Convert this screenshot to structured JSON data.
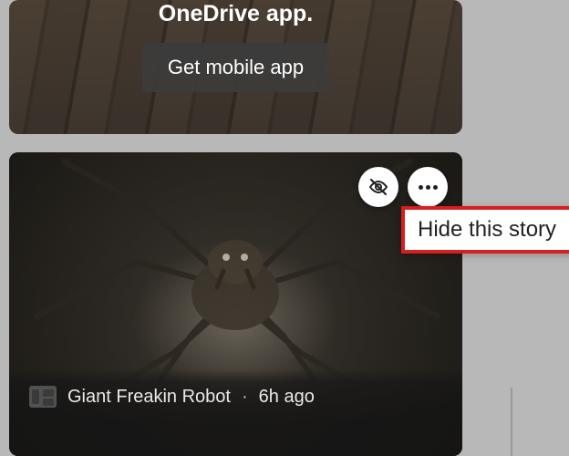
{
  "promo": {
    "line2": "OneDrive app.",
    "button": "Get mobile app"
  },
  "story": {
    "publisher": "Giant Freakin Robot",
    "separator": "·",
    "time": "6h ago"
  },
  "tooltip": {
    "text": "Hide this story"
  }
}
